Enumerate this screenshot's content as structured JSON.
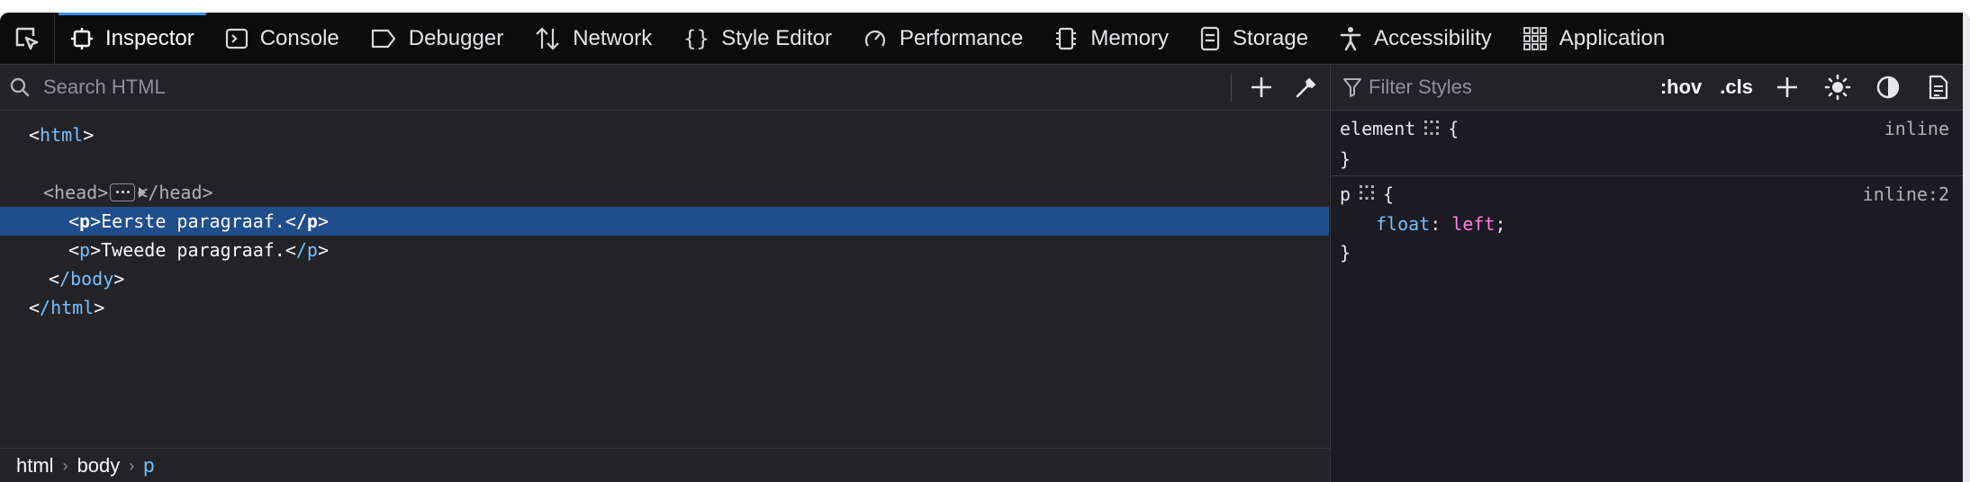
{
  "toolbar": {
    "tabs": [
      {
        "label": "Inspector",
        "icon": "inspector-icon"
      },
      {
        "label": "Console",
        "icon": "console-icon"
      },
      {
        "label": "Debugger",
        "icon": "debugger-icon"
      },
      {
        "label": "Network",
        "icon": "network-icon"
      },
      {
        "label": "Style Editor",
        "icon": "style-editor-icon"
      },
      {
        "label": "Performance",
        "icon": "performance-icon"
      },
      {
        "label": "Memory",
        "icon": "memory-icon"
      },
      {
        "label": "Storage",
        "icon": "storage-icon"
      },
      {
        "label": "Accessibility",
        "icon": "accessibility-icon"
      },
      {
        "label": "Application",
        "icon": "application-icon"
      }
    ],
    "selected_tab": "Inspector"
  },
  "markup": {
    "search_placeholder": "Search HTML",
    "tree": {
      "html_open": "html",
      "head": "head",
      "head_close": "/head",
      "body": "body",
      "p1_tag": "p",
      "p1_text": "Eerste paragraaf.",
      "p1_close": "/p",
      "p2_tag": "p",
      "p2_text": "Tweede paragraaf.",
      "p2_close": "/p",
      "body_close": "/body",
      "html_close": "/html"
    }
  },
  "breadcrumbs": [
    "html",
    "body",
    "p"
  ],
  "rules": {
    "filter_placeholder": "Filter Styles",
    "hov_label": ":hov",
    "cls_label": ".cls",
    "element_rule": {
      "selector": "element",
      "open": "{",
      "close": "}",
      "source": "inline"
    },
    "p_rule": {
      "selector": "p",
      "open": "{",
      "close": "}",
      "source": "inline:2",
      "property": "float",
      "value": "left"
    }
  },
  "colors": {
    "accent": "#3a8ee6",
    "selection": "#204e8a",
    "tag": "#75bfff",
    "value": "#ff7de9"
  }
}
